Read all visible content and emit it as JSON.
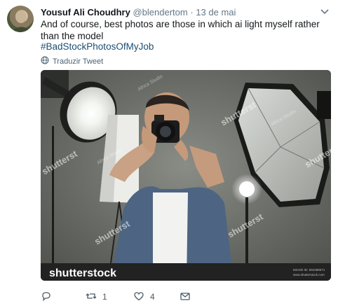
{
  "tweet": {
    "author_name": "Yousuf Ali Choudhry",
    "handle": "@blendertom",
    "separator": "·",
    "date": "13 de mai",
    "text": "And of course, best photos are those in which ai light myself rather than the model",
    "hashtag": "#BadStockPhotosOfMyJob",
    "translate_label": "Traduzir Tweet"
  },
  "media": {
    "watermark_brand": "shutterstock",
    "watermark_tile": "shutterst",
    "agency_tag": "Africa Studio",
    "image_id": "IMAGE ID: 562368671",
    "site": "www.shutterstock.com"
  },
  "actions": {
    "reply_count": "",
    "retweet_count": "1",
    "like_count": "4"
  },
  "icons": {
    "caret": "chevron-down-icon",
    "globe": "globe-icon",
    "reply": "reply-icon",
    "retweet": "retweet-icon",
    "like": "heart-icon",
    "message": "envelope-icon"
  }
}
